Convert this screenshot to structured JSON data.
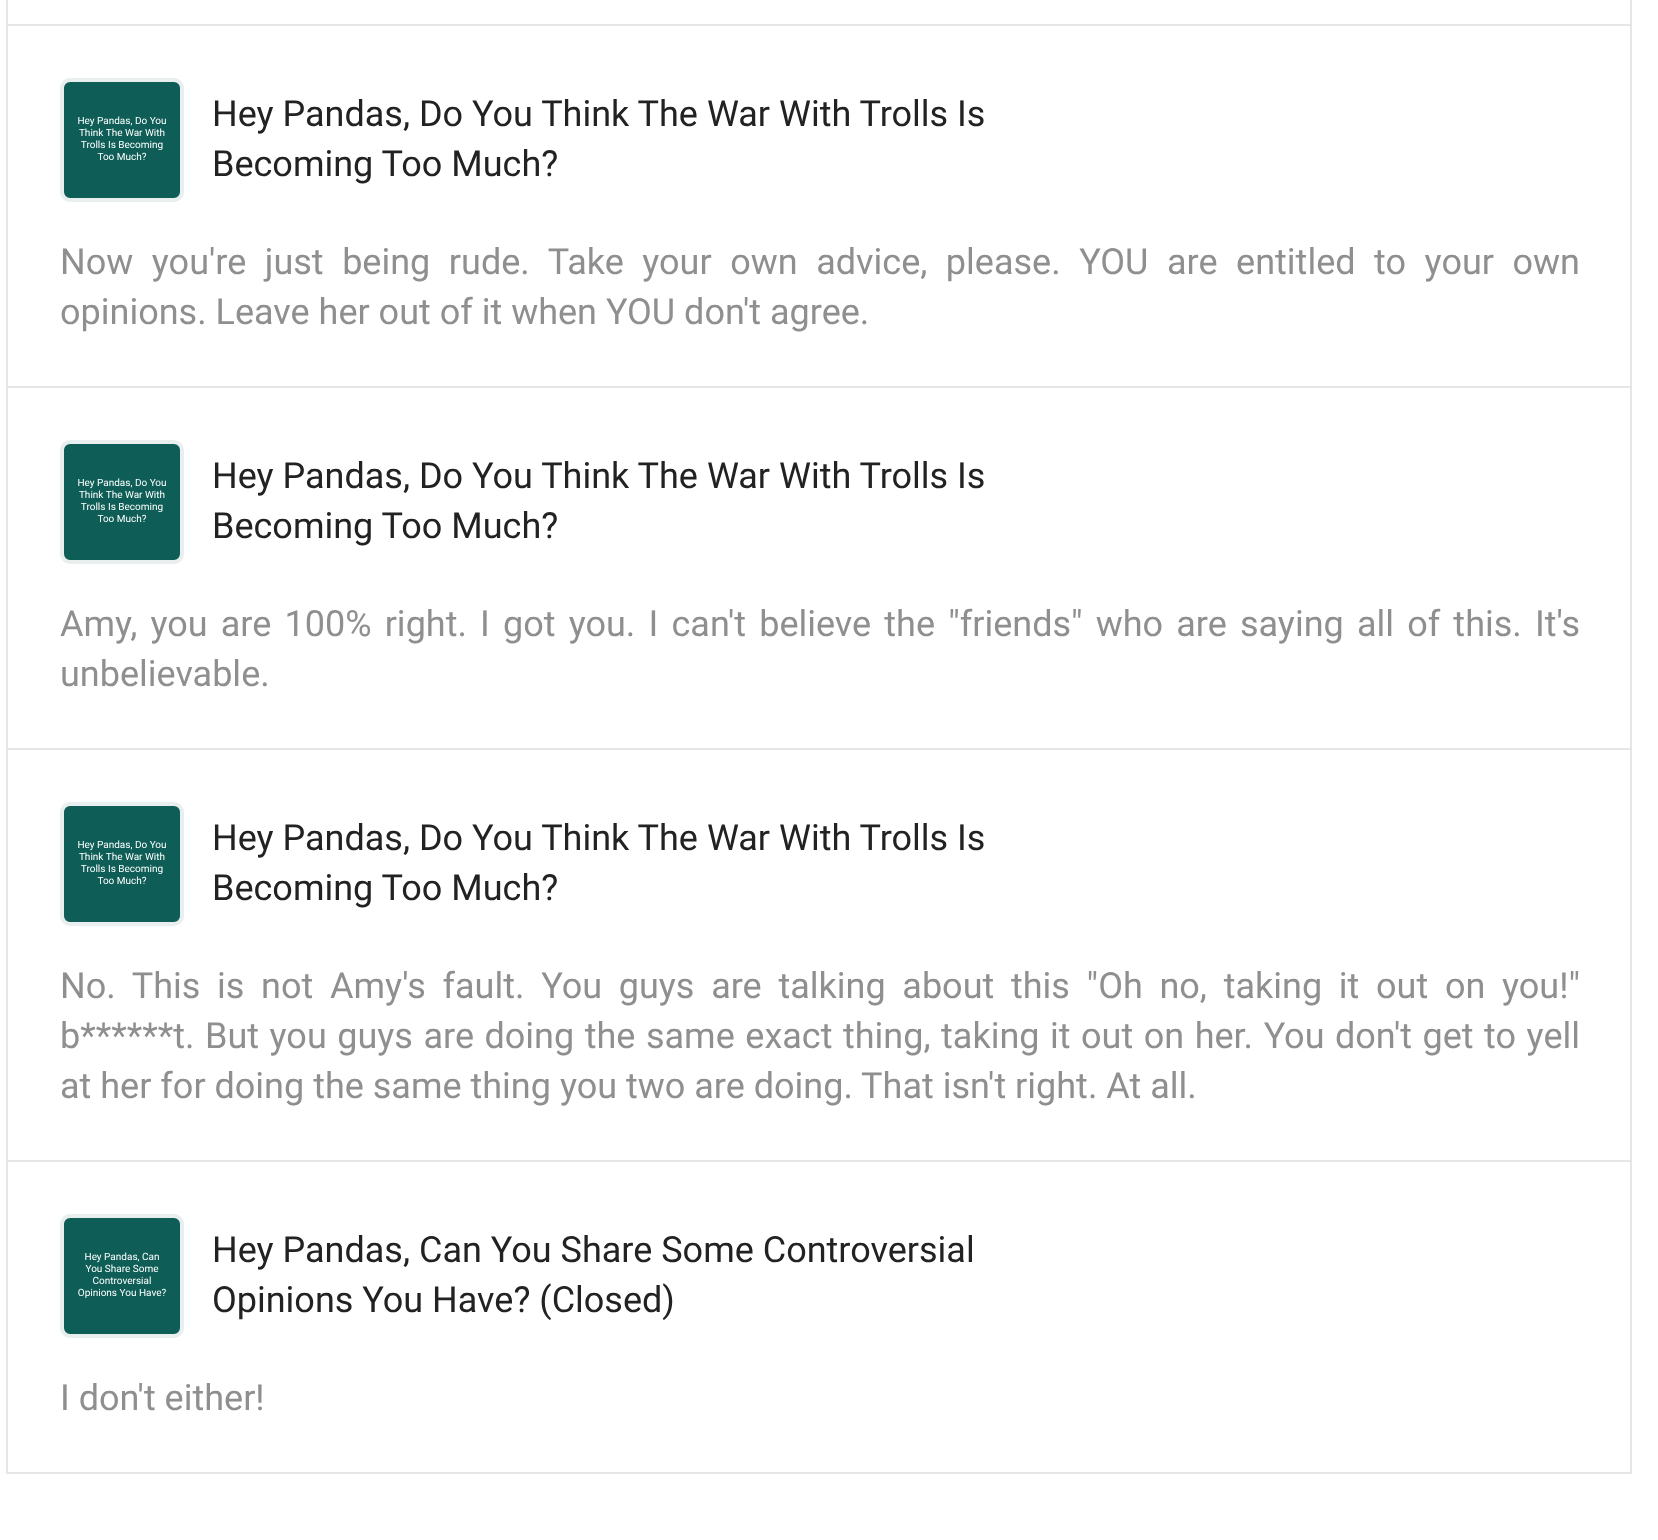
{
  "comments": [
    {
      "thumbnail_text": "Hey Pandas, Do You Think The War With Trolls Is Becoming Too Much?",
      "title": "Hey Pandas, Do You Think The War With Trolls Is Becoming Too Much?",
      "body": "Now you're just being rude. Take your own advice, please. YOU are entitled to your own opinions. Leave her out of it when YOU don't agree."
    },
    {
      "thumbnail_text": "Hey Pandas, Do You Think The War With Trolls Is Becoming Too Much?",
      "title": "Hey Pandas, Do You Think The War With Trolls Is Becoming Too Much?",
      "body": "Amy, you are 100% right. I got you. I can't believe the \"friends\" who are saying all of this. It's unbelievable."
    },
    {
      "thumbnail_text": "Hey Pandas, Do You Think The War With Trolls Is Becoming Too Much?",
      "title": "Hey Pandas, Do You Think The War With Trolls Is Becoming Too Much?",
      "body": "No. This is not Amy's fault. You guys are talking about this \"Oh no, taking it out on you!\" b******t. But you guys are doing the same exact thing, taking it out on her. You don't get to yell at her for doing the same thing you two are doing. That isn't right. At all."
    },
    {
      "thumbnail_text": "Hey Pandas, Can You Share Some Controversial Opinions You Have?",
      "title": "Hey Pandas, Can You Share Some Controversial Opinions You Have? (Closed)",
      "body": "I don't either!"
    }
  ]
}
